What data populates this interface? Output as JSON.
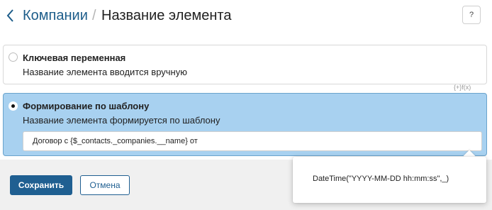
{
  "header": {
    "back_link": "Компании",
    "separator": "/",
    "title": "Название элемента",
    "help_icon": "?"
  },
  "options": [
    {
      "title": "Ключевая переменная",
      "description": "Название элемента вводится вручную",
      "selected": false
    },
    {
      "title": "Формирование по шаблону",
      "description": "Название элемента формируется по шаблону",
      "selected": true,
      "input_value": "Договор с {$_contacts._companies.__name} от",
      "function_icon": "{+}f(x)"
    }
  ],
  "popup": {
    "text": "DateTime(\"YYYY-MM-DD hh:mm:ss\",_)"
  },
  "footer": {
    "save_label": "Сохранить",
    "cancel_label": "Отмена"
  },
  "colors": {
    "accent": "#1f5f91",
    "link": "#1d5d8a",
    "selected_option_bg": "#a8d1f0"
  }
}
